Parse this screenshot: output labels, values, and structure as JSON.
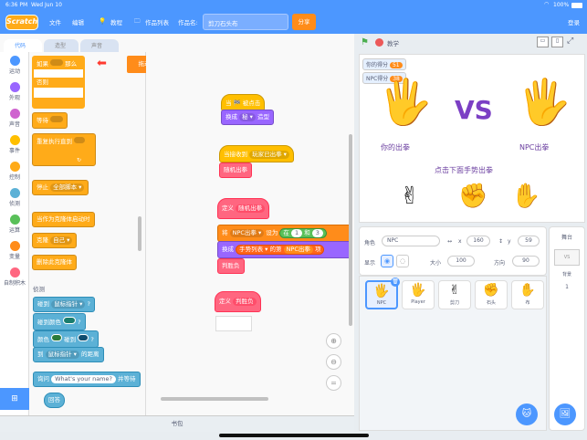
{
  "status": {
    "time": "6:36 PM",
    "date": "Wed Jun 10",
    "battery": "100%"
  },
  "topbar": {
    "logo": "Scratch",
    "file": "文件",
    "edit": "编辑",
    "tutorial": "教程",
    "projects": "作品列表",
    "name_label": "作品名:",
    "project_name": "剪刀石头布",
    "share": "分享",
    "login": "登录"
  },
  "tabs": {
    "code": "代码",
    "costume": "造型",
    "sound": "声音"
  },
  "categories": [
    {
      "label": "运动",
      "color": "#4c97ff"
    },
    {
      "label": "外观",
      "color": "#9966ff"
    },
    {
      "label": "声音",
      "color": "#cf63cf"
    },
    {
      "label": "事件",
      "color": "#ffbf00"
    },
    {
      "label": "控制",
      "color": "#ffab19"
    },
    {
      "label": "侦测",
      "color": "#5cb1d6"
    },
    {
      "label": "运算",
      "color": "#59c059"
    },
    {
      "label": "变量",
      "color": "#ff8c1a"
    },
    {
      "label": "自制积木",
      "color": "#ff6680"
    }
  ],
  "palette": {
    "if": "如果",
    "then": "那么",
    "else": "否则",
    "wait_until": "等待",
    "repeat_until": "重复执行直到",
    "stop": "停止",
    "stop_opt": "全部脚本",
    "clone_start": "当作为克隆体启动时",
    "clone": "克隆",
    "clone_opt": "自己",
    "delete_clone": "删除此克隆体",
    "sensing_header": "侦测",
    "touching": "碰到",
    "mouse_ptr": "鼠标指针",
    "touch_color": "碰到颜色",
    "color": "颜色",
    "touch_q": "?",
    "to": "到",
    "distance": "的距离",
    "ask": "询问",
    "ask_text": "What's your name?",
    "and_wait": "并等待",
    "answer": "回答"
  },
  "tip": "拖动高亮积木块到目标位置",
  "script": {
    "flag_clicked": "当 🏁 被点击",
    "switch_costume": "换成",
    "costume_opt": "秘",
    "costume_word": "造型",
    "broadcast_recv": "当接收到",
    "broadcast_msg": "玩家已出拳",
    "random_punch": "随机出拳",
    "define": "定义",
    "define_name": "随机出拳",
    "set": "将",
    "set_var": "NPC出拳",
    "set_to": "设为",
    "in": "在",
    "n1": "1",
    "and": "和",
    "n3": "3",
    "switch2": "换成",
    "list": "手势列表",
    "of": "的第",
    "item_var": "NPC出拳",
    "item": "项",
    "judge": "判胜负",
    "define2": "定义",
    "judge2": "判胜负"
  },
  "backpack": "书包",
  "stage_header": {
    "flag": "",
    "label": "教学"
  },
  "stage": {
    "player_score_label": "你的得分",
    "player_score": "51",
    "npc_score_label": "NPC得分",
    "npc_score": "38",
    "vs": "VS",
    "player_punch": "你的出拳",
    "npc_punch": "NPC出拳",
    "prompt": "点击下面手势出拳"
  },
  "sprite_info": {
    "role_label": "角色",
    "role": "NPC",
    "x_label": "x",
    "x": "160",
    "y_label": "y",
    "y": "59",
    "show_label": "显示",
    "size_label": "大小",
    "size": "100",
    "dir_label": "方向",
    "dir": "90"
  },
  "sprites": [
    {
      "name": "NPC",
      "selected": true
    },
    {
      "name": "Player",
      "selected": false
    },
    {
      "name": "剪刀",
      "selected": false
    },
    {
      "name": "石头",
      "selected": false
    },
    {
      "name": "布",
      "selected": false
    }
  ],
  "stage_col": {
    "title": "舞台",
    "bg_label": "背景",
    "bg_count": "1"
  }
}
